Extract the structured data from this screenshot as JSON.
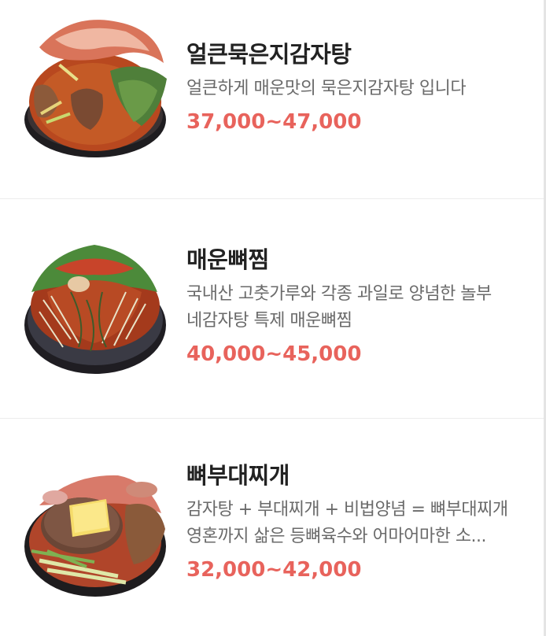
{
  "menu": {
    "items": [
      {
        "name": "얼큰묵은지감자탕",
        "description_lines": [
          "얼큰하게 매운맛의 묵은지감자탕 입니다"
        ],
        "price": "37,000~47,000",
        "image_icon": "kimchi-pork-bone-stew-photo"
      },
      {
        "name": "매운뼈찜",
        "description_lines": [
          "국내산 고춧가루와 각종 과일로 양념한 놀부",
          "네감자탕 특제 매운뼈찜"
        ],
        "price": "40,000~45,000",
        "image_icon": "spicy-braised-pork-bone-photo"
      },
      {
        "name": "뼈부대찌개",
        "description_lines": [
          "감자탕 + 부대찌개 + 비법양념 = 뼈부대찌개",
          "영혼까지 삶은 등뼈육수와 어마어마한 소..."
        ],
        "price": "32,000~42,000",
        "image_icon": "army-stew-photo"
      }
    ]
  },
  "colors": {
    "price": "#e8635c",
    "title": "#222222",
    "description": "#6a6a6a",
    "divider": "#ececec"
  }
}
